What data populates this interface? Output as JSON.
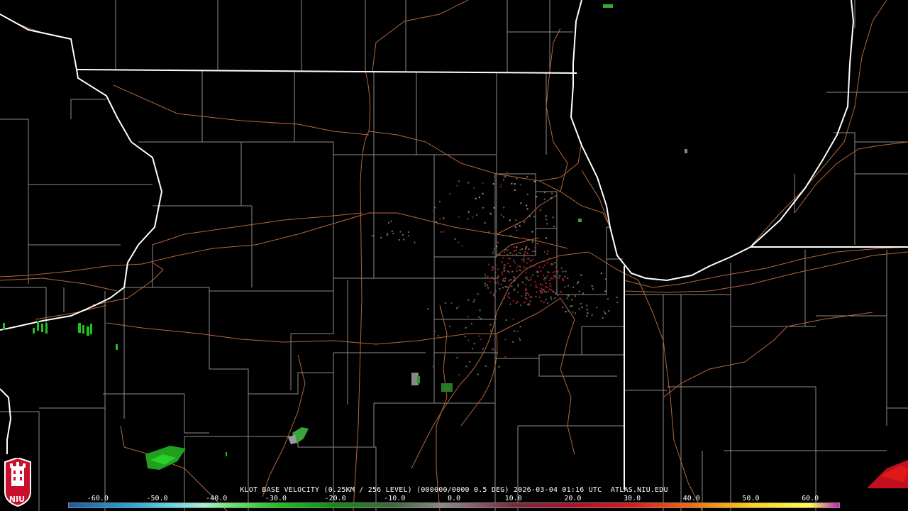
{
  "product": {
    "title": "KLOT BASE VELOCITY (0.25KM / 256 LEVEL) (000000/0000 0.5 DEG) 2026-03-04 01:16 UTC  ATLAS.NIU.EDU"
  },
  "legend": {
    "ticks": [
      "-60.0",
      "-50.0",
      "-40.0",
      "-30.0",
      "-20.0",
      "-10.0",
      "0.0",
      "10.0",
      "20.0",
      "30.0",
      "40.0",
      "50.0",
      "60.0"
    ],
    "min": -65,
    "max": 65,
    "color_stops": [
      {
        "value": -65,
        "color": "#1a5aa8"
      },
      {
        "value": -55,
        "color": "#2a9fd6"
      },
      {
        "value": -48,
        "color": "#5fd3e8"
      },
      {
        "value": -42,
        "color": "#a8f0d0"
      },
      {
        "value": -38,
        "color": "#6de86d"
      },
      {
        "value": -30,
        "color": "#1fc21f"
      },
      {
        "value": -20,
        "color": "#0e8e0e"
      },
      {
        "value": -10,
        "color": "#3d6a3d"
      },
      {
        "value": -2,
        "color": "#8a8a8a"
      },
      {
        "value": 2,
        "color": "#8a6a7a"
      },
      {
        "value": 10,
        "color": "#7a2a3a"
      },
      {
        "value": 20,
        "color": "#b0102a"
      },
      {
        "value": 30,
        "color": "#e01818"
      },
      {
        "value": 40,
        "color": "#f06a10"
      },
      {
        "value": 50,
        "color": "#ffd010"
      },
      {
        "value": 60,
        "color": "#ffff50"
      },
      {
        "value": 65,
        "color": "#c020c0"
      }
    ]
  },
  "logo": {
    "text": "NIU",
    "color": "#c8102e"
  },
  "map_colors": {
    "background": "#000000",
    "state_border": "#ffffff",
    "county_border": "#8c8c8c",
    "highway": "#b5673a"
  }
}
